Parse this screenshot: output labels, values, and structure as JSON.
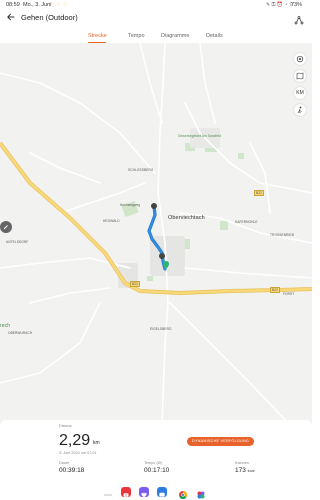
{
  "status_bar": {
    "time": "08:59",
    "date": "Mo., 3. Juni",
    "notifications": "⬚ ♡ ♡",
    "system_icons": "✎ ⚿ ⏰ ◔ ⌔",
    "battery": "73%"
  },
  "header": {
    "title": "Gehen (Outdoor)",
    "back_icon": "arrow-left-icon",
    "share_icon": "share-icon"
  },
  "tabs": [
    {
      "label": "Strecke",
      "active": true
    },
    {
      "label": "Tempo",
      "active": false
    },
    {
      "label": "Diagramme",
      "active": false
    },
    {
      "label": "Details",
      "active": false
    }
  ],
  "map": {
    "town": "Oberviechtach",
    "labels": {
      "poi": "Gewerbegebiet Am Sandfeld",
      "schlossberg": "SCHLOSSBERG",
      "kaffernohle": "KAFERNOHLE",
      "trossenried": "TROSSENRIED",
      "antelsdorf": "ANTELSDORF",
      "forst": "FORST",
      "eigelsberg": "EIGELSBERG",
      "mitzling": "MITZING",
      "ober": "OBERWURACH",
      "rech": "rech",
      "hegwald": "HEGWALD",
      "hoch": "Hochwegweg",
      "road_top": "B22",
      "road_right": "B22",
      "road_left": "B22"
    },
    "buttons": [
      "target-icon",
      "map-layers-icon",
      "km-icon",
      "activity-icon"
    ],
    "km_label": "KM",
    "route_color": "#2f8de4",
    "accent": "#e8632c"
  },
  "summary": {
    "distance_label": "Distanz",
    "distance": "2,29",
    "distance_unit": "km",
    "date": "3. Juni 2024 um 07:01",
    "dynamic_button": "DYNAMISCHE VERFOLGUNG",
    "duration_label": "Dauer",
    "duration": "00:39:18",
    "pace_label": "Tempo (Ø)",
    "pace": "00:17:10",
    "calories_label": "Kalorien",
    "calories": "173",
    "calories_unit": "kcal"
  },
  "dock_apps": [
    "youtube-icon",
    "health-icon",
    "messages-icon",
    "assistant-icon",
    "chrome-icon",
    "multi-app-icon"
  ]
}
